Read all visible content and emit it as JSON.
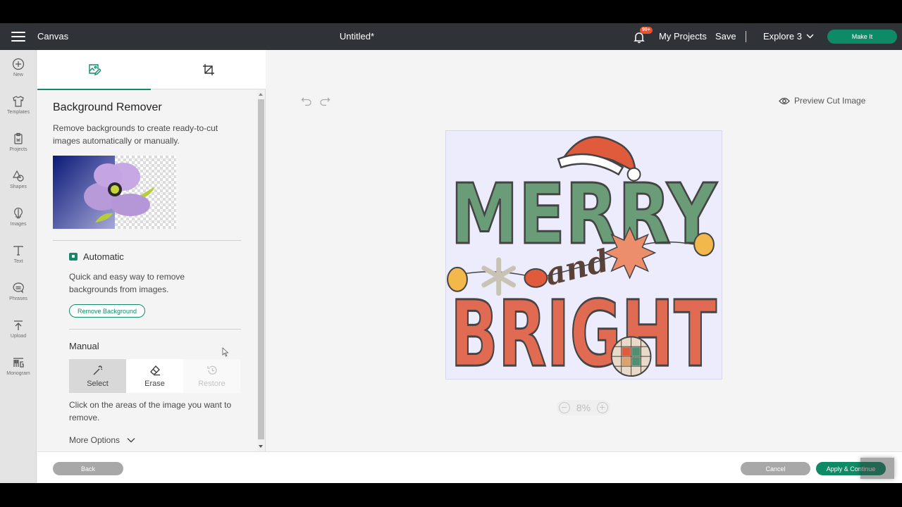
{
  "topbar": {
    "menu_icon": "hamburger-icon",
    "app_name": "Canvas",
    "doc_title": "Untitled*",
    "notification_icon": "bell-icon",
    "notification_count": "99+",
    "my_projects": "My Projects",
    "save": "Save",
    "machine": "Explore 3",
    "make_it": "Make It"
  },
  "rail": {
    "items": [
      {
        "label": "New",
        "icon": "plus-circle-icon"
      },
      {
        "label": "Templates",
        "icon": "shirt-icon"
      },
      {
        "label": "Projects",
        "icon": "clipboard-icon"
      },
      {
        "label": "Shapes",
        "icon": "shapes-icon"
      },
      {
        "label": "Images",
        "icon": "lightbulb-icon"
      },
      {
        "label": "Text",
        "icon": "text-icon"
      },
      {
        "label": "Phrases",
        "icon": "speech-bubble-icon"
      },
      {
        "label": "Upload",
        "icon": "upload-icon"
      },
      {
        "label": "Monogram",
        "icon": "monogram-icon"
      }
    ]
  },
  "panel": {
    "tabs": [
      {
        "name": "background-remover",
        "icon": "image-edit-icon",
        "active": true
      },
      {
        "name": "crop",
        "icon": "crop-icon",
        "active": false
      }
    ],
    "title": "Background Remover",
    "description": "Remove backgrounds to create ready-to-cut images automatically or manually.",
    "automatic": {
      "heading": "Automatic",
      "description": "Quick and easy way to remove backgrounds from images.",
      "button": "Remove Background"
    },
    "manual": {
      "heading": "Manual",
      "tools": [
        {
          "label": "Select",
          "icon": "magic-wand-icon",
          "state": "selected"
        },
        {
          "label": "Erase",
          "icon": "eraser-icon",
          "state": "enabled"
        },
        {
          "label": "Restore",
          "icon": "restore-icon",
          "state": "disabled"
        }
      ],
      "description": "Click on the areas of the image you want to remove.",
      "more_options": "More Options"
    }
  },
  "canvas": {
    "preview_cut": "Preview Cut Image",
    "artwork": {
      "line1": "MERRY",
      "connector": "and",
      "line2": "BRIGHT"
    },
    "zoom_level": "8%"
  },
  "footer": {
    "back": "Back",
    "cancel": "Cancel",
    "apply": "Apply & Continue"
  },
  "colors": {
    "accent": "#0f8a66",
    "topbar": "#2f3237",
    "badge": "#e8532f"
  }
}
